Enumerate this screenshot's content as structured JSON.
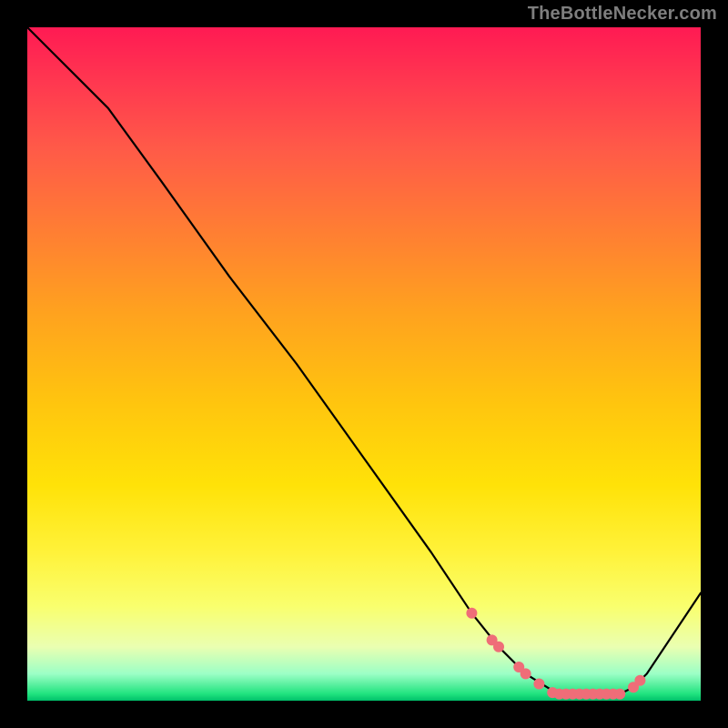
{
  "watermark": "TheBottleNecker.com",
  "chart_data": {
    "type": "line",
    "title": "",
    "xlabel": "",
    "ylabel": "",
    "xlim": [
      0,
      100
    ],
    "ylim": [
      0,
      100
    ],
    "grid": false,
    "legend": null,
    "series": [
      {
        "name": "curve",
        "x": [
          0,
          4,
          8,
          12,
          20,
          30,
          40,
          50,
          60,
          66,
          70,
          74,
          78,
          80,
          82,
          84,
          86,
          88,
          90,
          92,
          100
        ],
        "y": [
          100,
          96,
          92,
          88,
          77,
          63,
          50,
          36,
          22,
          13,
          8,
          4,
          1.5,
          1,
          1,
          1,
          1,
          1,
          2,
          4,
          16
        ]
      }
    ],
    "markers": {
      "name": "highlighted-points",
      "x": [
        66,
        69,
        70,
        73,
        74,
        76,
        78,
        79,
        80,
        81,
        82,
        83,
        84,
        85,
        86,
        87,
        88,
        90,
        91
      ],
      "y": [
        13,
        9,
        8,
        5,
        4,
        2.5,
        1.2,
        1,
        1,
        1,
        1,
        1,
        1,
        1,
        1,
        1,
        1,
        2,
        3
      ]
    },
    "gradient_stops": [
      {
        "pos": 0,
        "color": "#ff1a53"
      },
      {
        "pos": 18,
        "color": "#ff5a48"
      },
      {
        "pos": 42,
        "color": "#ffa11f"
      },
      {
        "pos": 68,
        "color": "#ffe208"
      },
      {
        "pos": 86,
        "color": "#f8ff6e"
      },
      {
        "pos": 96,
        "color": "#9cffc6"
      },
      {
        "pos": 100,
        "color": "#00c06a"
      }
    ]
  }
}
